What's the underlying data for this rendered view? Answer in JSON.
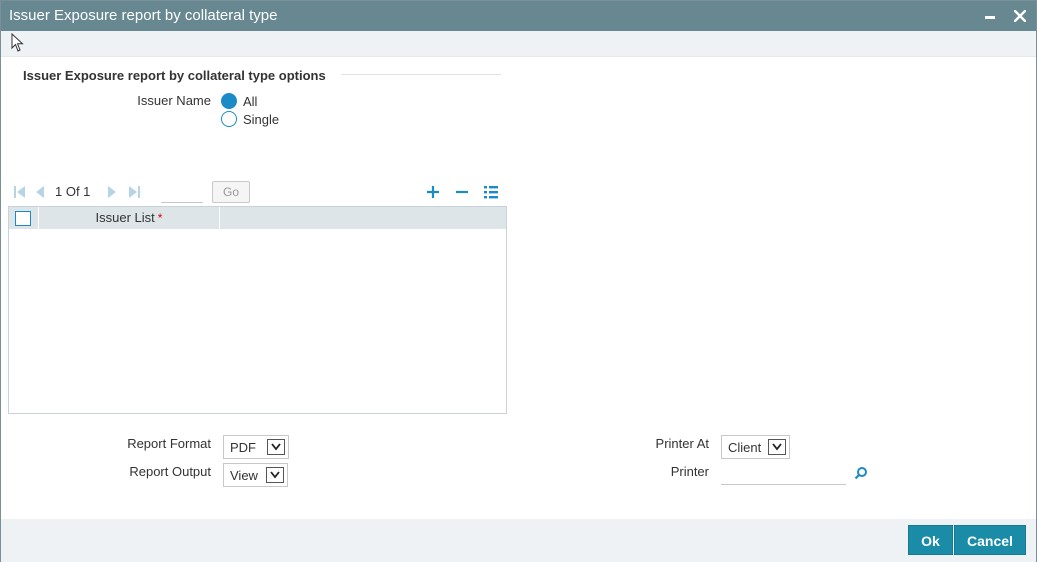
{
  "window": {
    "title": "Issuer Exposure report by collateral type"
  },
  "options": {
    "section_title": "Issuer Exposure report by collateral type options",
    "issuer_name_label": "Issuer Name",
    "radio_all": "All",
    "radio_single": "Single",
    "selected": "All"
  },
  "pager": {
    "page_text": "1 Of 1",
    "go_label": "Go"
  },
  "grid": {
    "column_issuer_list": "Issuer List",
    "required_mark": "*",
    "rows": []
  },
  "report": {
    "format_label": "Report Format",
    "format_value": "PDF",
    "output_label": "Report Output",
    "output_value": "View",
    "printer_at_label": "Printer At",
    "printer_at_value": "Client",
    "printer_label": "Printer",
    "printer_value": ""
  },
  "footer": {
    "ok_label": "Ok",
    "cancel_label": "Cancel"
  },
  "colors": {
    "titlebar": "#678891",
    "accent": "#1a8bc6",
    "button": "#1a8ca8",
    "grid_header": "#dde5e8"
  }
}
